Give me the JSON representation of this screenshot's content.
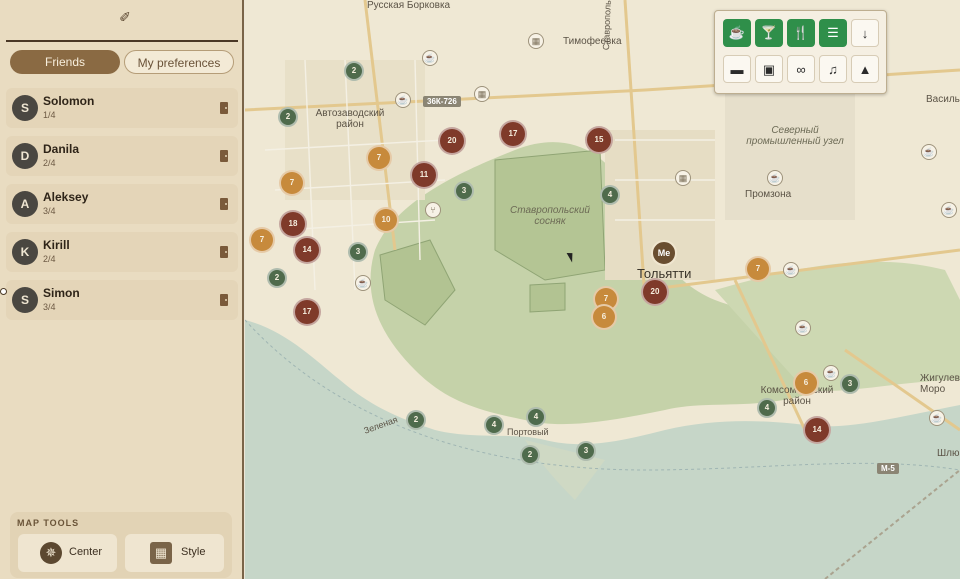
{
  "sidebar": {
    "tabs": [
      {
        "label": "Friends"
      },
      {
        "label": "My preferences"
      }
    ],
    "friends": [
      {
        "initial": "S",
        "name": "Solomon",
        "score": "1/4"
      },
      {
        "initial": "D",
        "name": "Danila",
        "score": "2/4"
      },
      {
        "initial": "A",
        "name": "Aleksey",
        "score": "3/4"
      },
      {
        "initial": "K",
        "name": "Kirill",
        "score": "2/4"
      },
      {
        "initial": "S",
        "name": "Simon",
        "score": "3/4"
      }
    ],
    "map_tools": {
      "title": "MAP TOOLS",
      "center_label": "Center",
      "style_label": "Style"
    }
  },
  "map": {
    "labels": {
      "russkaya_borkovka": "Русская Борковка",
      "timofeevka": "Тимофеевка",
      "stavropolsky_forest": "Ставропольский сосняк",
      "avtozavodsky": "Автозаводский район",
      "northern_zone": "Северный промышленный узел",
      "promzona": "Промзона",
      "togliatti": "Тольятти",
      "komsomolsky": "Комсомольский район",
      "zhigulevsk": "Жигулевск Моро",
      "vasil": "Васильев",
      "shlyuz": "Шлюз",
      "portovy": "Портовый",
      "stavropolskaya": "Ставропольская",
      "zelenaya": "Зеленая",
      "road_36k": "36К-726",
      "road_m5": "М-5"
    },
    "me_label": "Me",
    "clusters": [
      {
        "value": "2",
        "kind": "green"
      },
      {
        "value": "2",
        "kind": "green"
      },
      {
        "value": "20",
        "kind": "red"
      },
      {
        "value": "17",
        "kind": "red"
      },
      {
        "value": "15",
        "kind": "red"
      },
      {
        "value": "7",
        "kind": "orange"
      },
      {
        "value": "11",
        "kind": "red"
      },
      {
        "value": "3",
        "kind": "green"
      },
      {
        "value": "4",
        "kind": "green"
      },
      {
        "value": "7",
        "kind": "orange"
      },
      {
        "value": "10",
        "kind": "orange"
      },
      {
        "value": "18",
        "kind": "red"
      },
      {
        "value": "7",
        "kind": "orange"
      },
      {
        "value": "14",
        "kind": "red"
      },
      {
        "value": "3",
        "kind": "green"
      },
      {
        "value": "2",
        "kind": "green"
      },
      {
        "value": "17",
        "kind": "red"
      },
      {
        "value": "7",
        "kind": "orange"
      },
      {
        "value": "6",
        "kind": "orange"
      },
      {
        "value": "20",
        "kind": "red"
      },
      {
        "value": "7",
        "kind": "orange"
      },
      {
        "value": "6",
        "kind": "orange"
      },
      {
        "value": "3",
        "kind": "green"
      },
      {
        "value": "4",
        "kind": "green"
      },
      {
        "value": "14",
        "kind": "red"
      },
      {
        "value": "2",
        "kind": "green"
      },
      {
        "value": "4",
        "kind": "green"
      },
      {
        "value": "4",
        "kind": "green"
      },
      {
        "value": "2",
        "kind": "green"
      },
      {
        "value": "3",
        "kind": "green"
      }
    ]
  },
  "filters": [
    {
      "name": "coffee-icon",
      "active": true
    },
    {
      "name": "cocktail-icon",
      "active": true
    },
    {
      "name": "restaurant-icon",
      "active": true
    },
    {
      "name": "fastfood-icon",
      "active": true
    },
    {
      "name": "more-arrow-icon",
      "active": false
    },
    {
      "name": "ticket-icon",
      "active": false
    },
    {
      "name": "film-icon",
      "active": false
    },
    {
      "name": "theater-mask-icon",
      "active": false
    },
    {
      "name": "music-icon",
      "active": false
    },
    {
      "name": "tree-icon",
      "active": false
    }
  ],
  "colors": {
    "accent": "#8a6a43",
    "filter_active": "#2f8f4a",
    "cluster_green": "#4f6b4c",
    "cluster_orange": "#c78a3c",
    "cluster_red": "#7f3a2a"
  }
}
